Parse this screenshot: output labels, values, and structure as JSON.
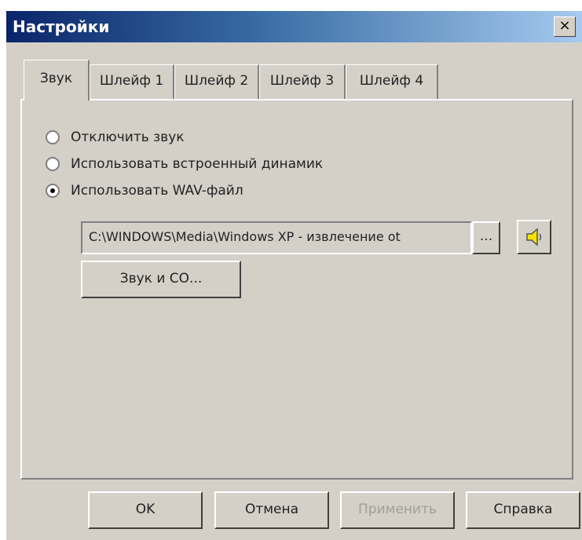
{
  "window": {
    "title": "Настройки",
    "close_label": "×"
  },
  "tabs": [
    {
      "label": "Звук",
      "active": true
    },
    {
      "label": "Шлейф 1",
      "active": false
    },
    {
      "label": "Шлейф 2",
      "active": false
    },
    {
      "label": "Шлейф 3",
      "active": false
    },
    {
      "label": "Шлейф 4",
      "active": false
    }
  ],
  "sound": {
    "options": [
      {
        "label": "Отключить звук",
        "checked": false
      },
      {
        "label": "Использовать встроенный динамик",
        "checked": false
      },
      {
        "label": "Использовать WAV-файл",
        "checked": true
      }
    ],
    "wav_path": "C:\\WINDOWS\\Media\\Windows XP - извлечение ot",
    "browse_label": "...",
    "speaker_icon": "speaker-icon",
    "sound_button_label": "Звук и СО..."
  },
  "footer": {
    "ok_label": "OK",
    "cancel_label": "Отмена",
    "apply_label": "Применить",
    "help_label": "Справка"
  },
  "colors": {
    "face": "#d4d0c8",
    "title_start": "#0a246a",
    "title_end": "#a6caf0",
    "speaker": "#f5e400"
  }
}
